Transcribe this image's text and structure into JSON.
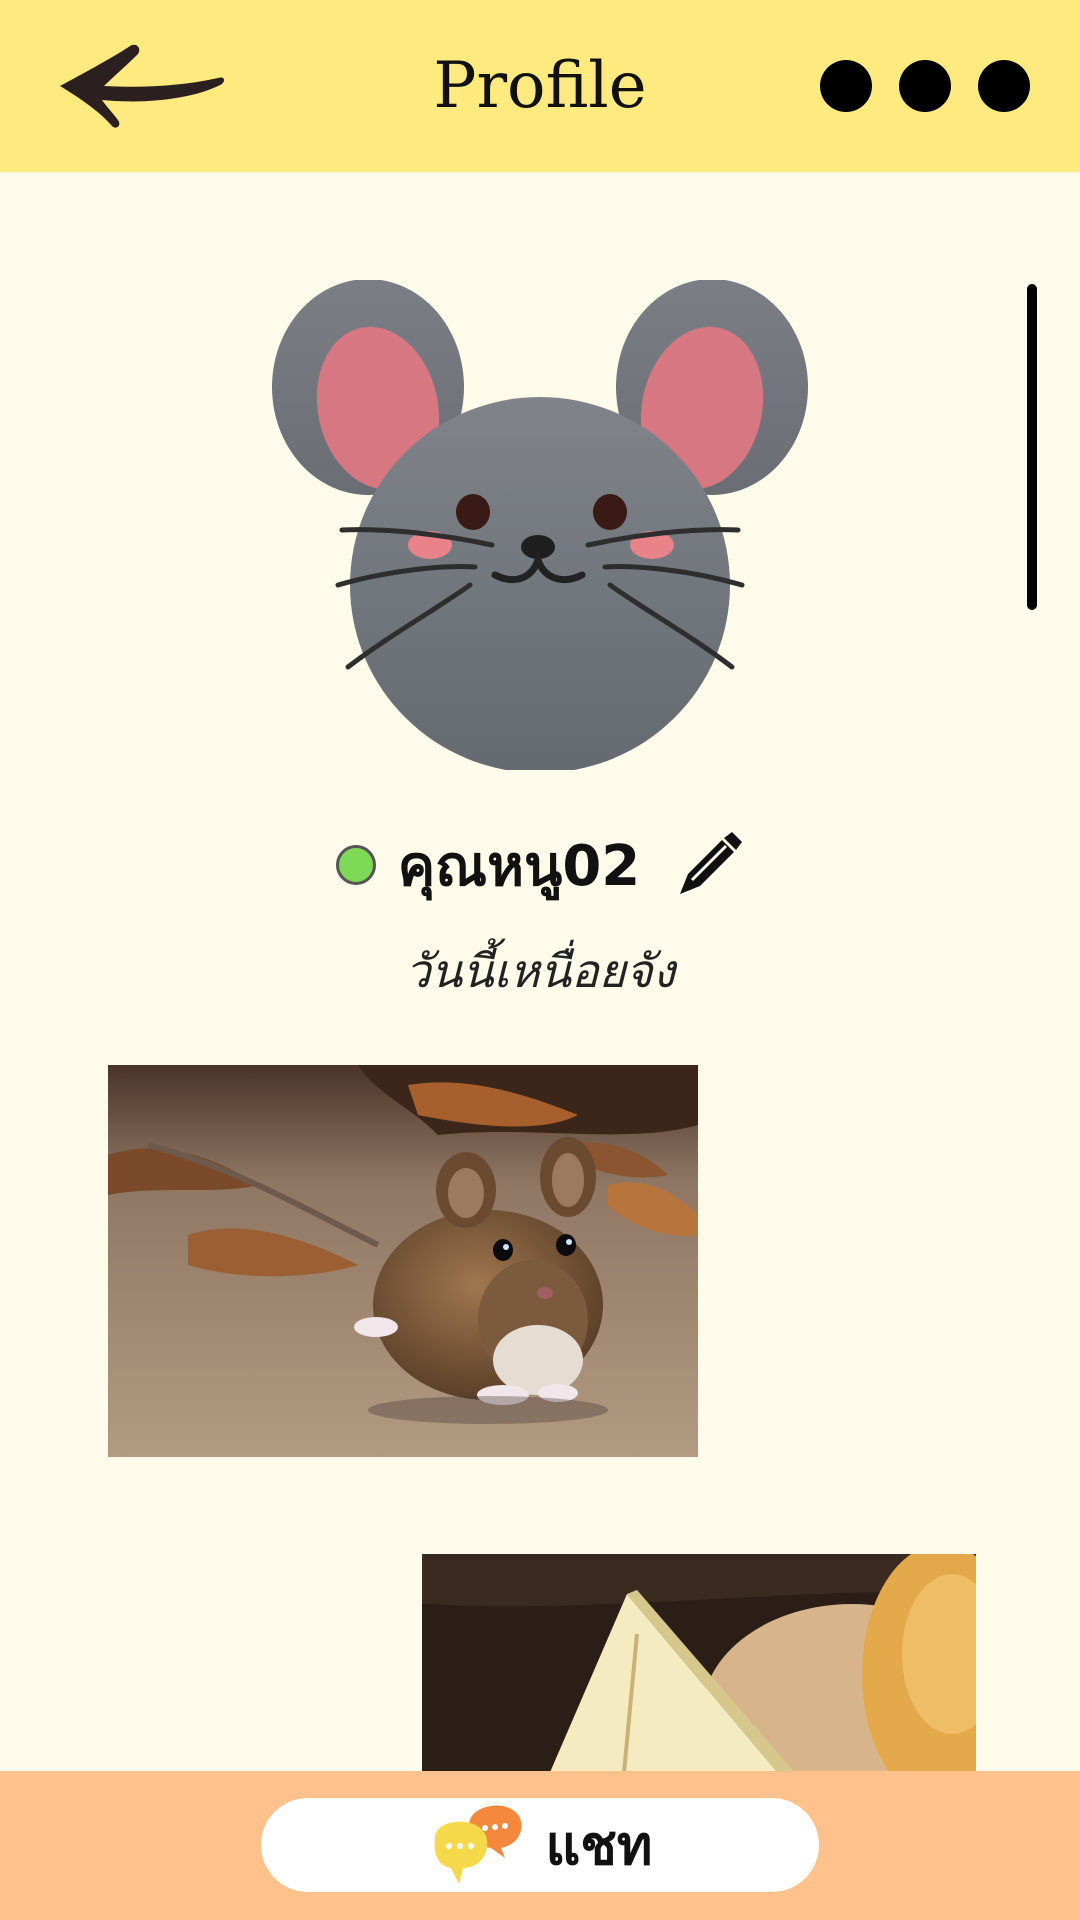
{
  "header": {
    "title": "Profile",
    "back_icon": "back-arrow-icon",
    "more_icon": "more-dots-icon"
  },
  "profile": {
    "avatar_icon": "mouse-face-avatar",
    "status_color": "#7ed957",
    "name": "คุณหนู02",
    "edit_icon": "pen-icon",
    "status_message": "วันนี้เหนื่อยจัง"
  },
  "gallery": {
    "photos": [
      {
        "subject": "mouse on the ground"
      },
      {
        "subject": "cheese"
      }
    ]
  },
  "bottom_bar": {
    "chat_label": "แชท",
    "chat_icon": "chat-bubbles-icon"
  },
  "colors": {
    "header_bg": "#ffea80",
    "page_bg": "#fffbeb",
    "bottom_bar_bg": "#ffc28c"
  }
}
